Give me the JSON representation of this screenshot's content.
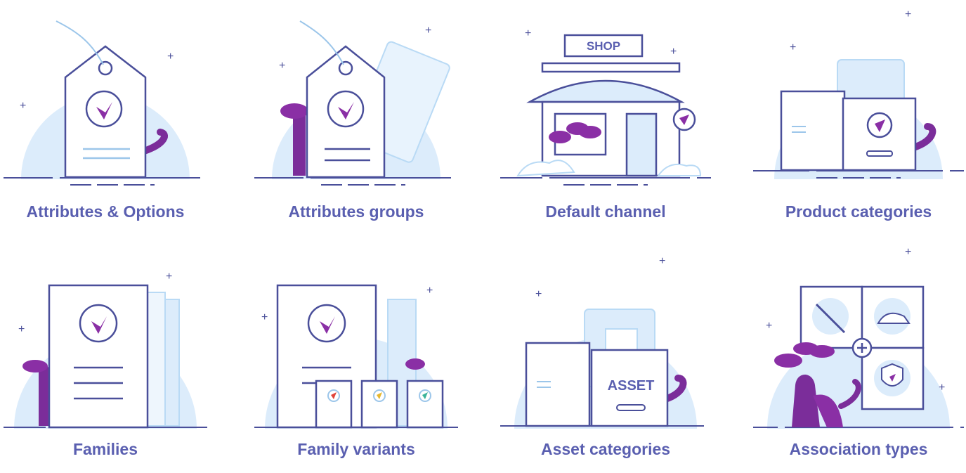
{
  "colors": {
    "accent": "#5a5fb0",
    "stroke": "#4a4f9a",
    "light_blue": "#dcecfb",
    "mid_blue": "#b9daf5",
    "purple": "#7b2d9a",
    "dragon": "#8a2fa5",
    "background": "#ffffff"
  },
  "cards": [
    {
      "label": "Attributes & Options",
      "icon": "tag-icon"
    },
    {
      "label": "Attributes groups",
      "icon": "tag-stack-icon"
    },
    {
      "label": "Default channel",
      "icon": "shop-icon",
      "sign": "SHOP"
    },
    {
      "label": "Product categories",
      "icon": "folder-drawer-icon"
    },
    {
      "label": "Families",
      "icon": "document-stack-icon"
    },
    {
      "label": "Family variants",
      "icon": "variant-cards-icon"
    },
    {
      "label": "Asset categories",
      "icon": "asset-drawer-icon",
      "sign": "ASSET"
    },
    {
      "label": "Association types",
      "icon": "association-grid-icon"
    }
  ]
}
